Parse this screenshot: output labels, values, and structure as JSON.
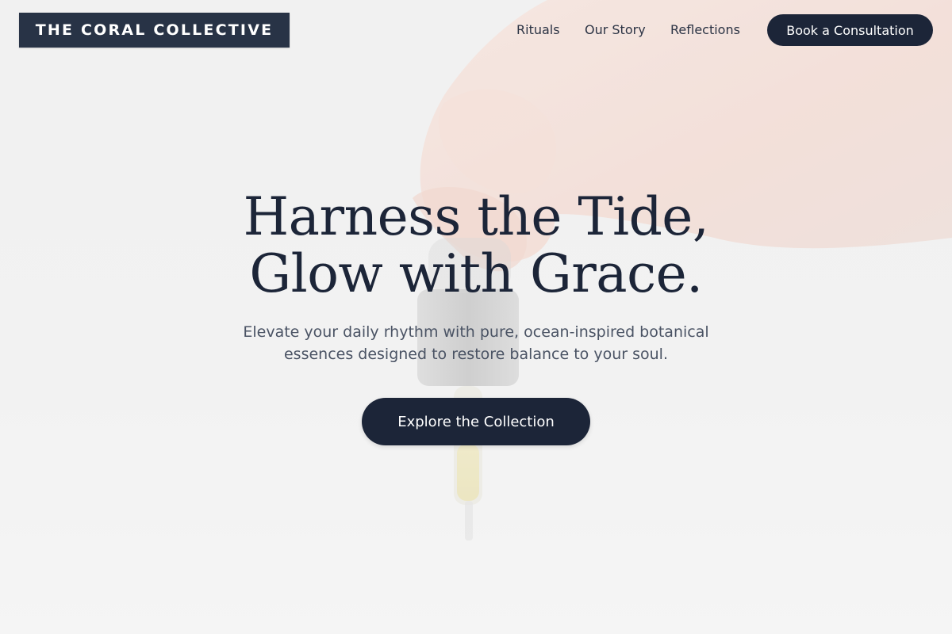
{
  "brand": {
    "name": "THE CORAL COLLECTIVE"
  },
  "nav": {
    "links": [
      {
        "label": "Rituals"
      },
      {
        "label": "Our Story"
      },
      {
        "label": "Reflections"
      }
    ],
    "cta_label": "Book a Consultation"
  },
  "hero": {
    "headline_line1": "Harness the Tide,",
    "headline_line2": "Glow with Grace.",
    "subtext_line1": "Elevate your daily rhythm with pure, ocean-inspired botanical",
    "subtext_line2": "essences designed to restore balance to your soul.",
    "cta_label": "Explore the Collection",
    "background_image": "hand-holding-dropper-bottle"
  },
  "colors": {
    "primary": "#1c2538",
    "brand_box": "#283346",
    "body_text": "#4a5364",
    "background": "#f1f1f1"
  }
}
